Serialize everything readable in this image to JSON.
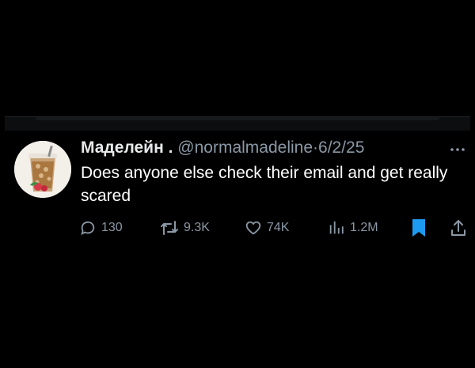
{
  "tweet": {
    "display_name": "Маделейн .",
    "handle": "@normalmadeline",
    "separator": "·",
    "date": "6/2/25",
    "text": "Does anyone else check their email and get really scared",
    "actions": {
      "replies": "130",
      "reposts": "9.3K",
      "likes": "74K",
      "views": "1.2M"
    }
  },
  "icons": {
    "reply": "reply-icon",
    "repost": "repost-icon",
    "like": "heart-icon",
    "views": "views-icon",
    "bookmark": "bookmark-icon",
    "share": "share-icon",
    "more": "more-icon"
  },
  "colors": {
    "background": "#000000",
    "text": "#ffffff",
    "muted": "#8b98a5",
    "bookmark_active": "#1d9bf0"
  }
}
